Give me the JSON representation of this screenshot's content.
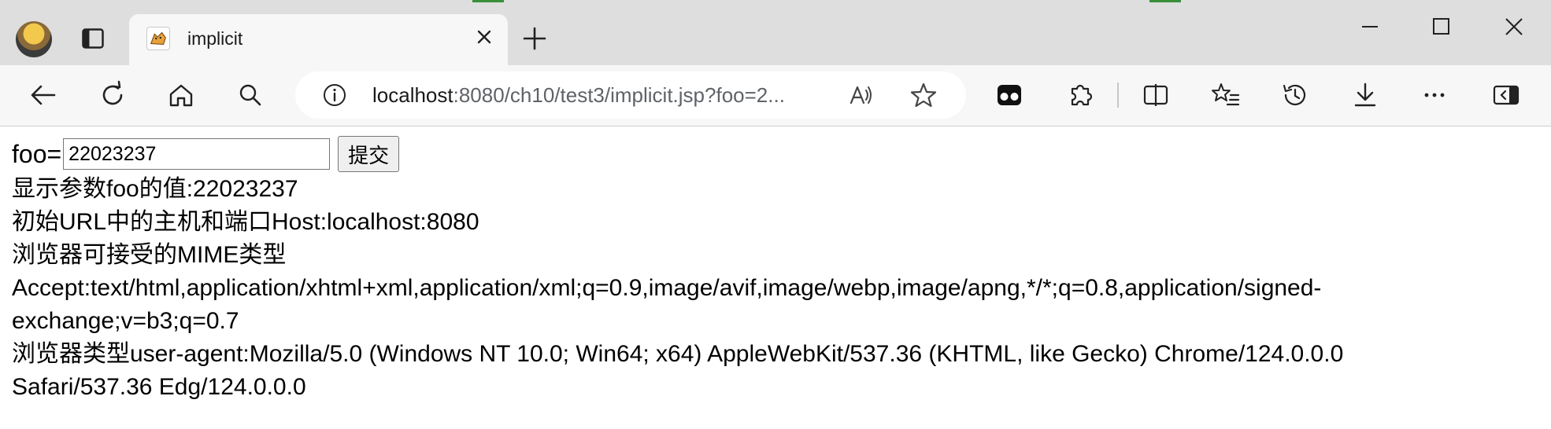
{
  "browser": {
    "tab": {
      "title": "implicit"
    },
    "address_bar": {
      "url_host": "localhost",
      "url_rest": ":8080/ch10/test3/implicit.jsp?foo=2..."
    }
  },
  "page": {
    "form": {
      "label": "foo=",
      "input_value": "22023237",
      "submit_label": "提交"
    },
    "lines": [
      "显示参数foo的值:22023237",
      "初始URL中的主机和端口Host:localhost:8080",
      "浏览器可接受的MIME类型",
      "Accept:text/html,application/xhtml+xml,application/xml;q=0.9,image/avif,image/webp,image/apng,*/*;q=0.8,application/signed-",
      "exchange;v=b3;q=0.7",
      "浏览器类型user-agent:Mozilla/5.0 (Windows NT 10.0; Win64; x64) AppleWebKit/537.36 (KHTML, like Gecko) Chrome/124.0.0.0",
      "Safari/537.36 Edg/124.0.0.0"
    ]
  },
  "colors": {
    "tabbar_bg": "#dedede",
    "toolbar_bg": "#f7f7f7",
    "accent_green": "#3a8f3a"
  }
}
